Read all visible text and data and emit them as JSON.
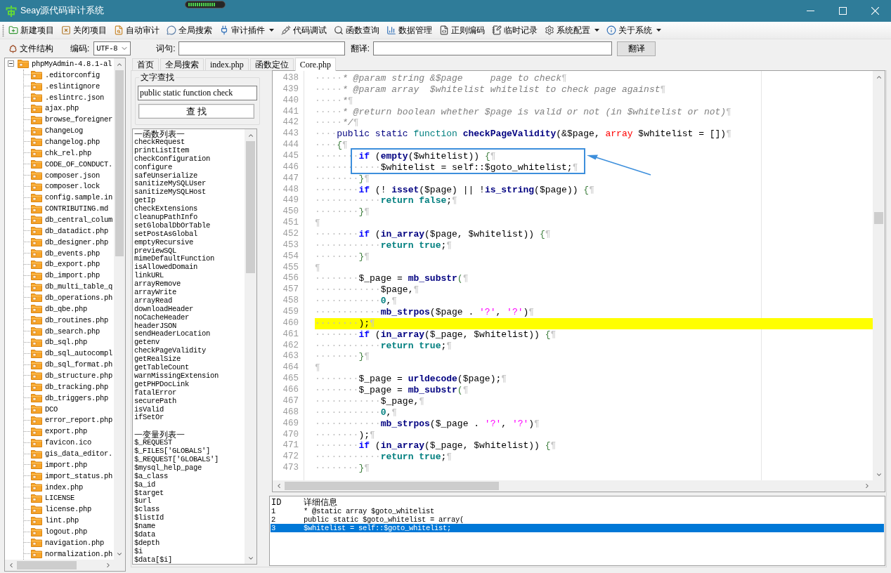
{
  "window": {
    "title": "Seay源代码审计系统"
  },
  "capture_meter": {
    "level": 0.8
  },
  "toolbar": [
    {
      "label": "新建项目",
      "dropdown": false
    },
    {
      "label": "关闭项目",
      "dropdown": false
    },
    {
      "label": "自动审计",
      "dropdown": false
    },
    {
      "label": "全局搜索",
      "dropdown": false
    },
    {
      "label": "审计插件",
      "dropdown": true
    },
    {
      "label": "代码调试",
      "dropdown": false
    },
    {
      "label": "函数查询",
      "dropdown": false
    },
    {
      "label": "数据管理",
      "dropdown": false
    },
    {
      "label": "正则编码",
      "dropdown": false
    },
    {
      "label": "临时记录",
      "dropdown": false
    },
    {
      "label": "系统配置",
      "dropdown": true
    },
    {
      "label": "关于系统",
      "dropdown": true
    }
  ],
  "options_bar": {
    "structure_button": "文件结构",
    "encoding": {
      "label": "编码:",
      "value": "UTF-8"
    },
    "phrase_label": "词句:",
    "translation_label": "翻译:",
    "translate_button": "翻译"
  },
  "file_tree": {
    "label": "phpMyAdmin-4.8.1-al",
    "expanded": true,
    "children": [
      {
        "label": ".editorconfig"
      },
      {
        "label": ".eslintignore"
      },
      {
        "label": ".eslintrc.json"
      },
      {
        "label": "ajax.php"
      },
      {
        "label": "browse_foreigner"
      },
      {
        "label": "ChangeLog"
      },
      {
        "label": "changelog.php"
      },
      {
        "label": "chk_rel.php"
      },
      {
        "label": "CODE_OF_CONDUCT."
      },
      {
        "label": "composer.json"
      },
      {
        "label": "composer.lock"
      },
      {
        "label": "config.sample.in"
      },
      {
        "label": "CONTRIBUTING.md"
      },
      {
        "label": "db_central_colum"
      },
      {
        "label": "db_datadict.php"
      },
      {
        "label": "db_designer.php"
      },
      {
        "label": "db_events.php"
      },
      {
        "label": "db_export.php"
      },
      {
        "label": "db_import.php"
      },
      {
        "label": "db_multi_table_q"
      },
      {
        "label": "db_operations.ph"
      },
      {
        "label": "db_qbe.php"
      },
      {
        "label": "db_routines.php"
      },
      {
        "label": "db_search.php"
      },
      {
        "label": "db_sql.php"
      },
      {
        "label": "db_sql_autocompl"
      },
      {
        "label": "db_sql_format.ph"
      },
      {
        "label": "db_structure.php"
      },
      {
        "label": "db_tracking.php"
      },
      {
        "label": "db_triggers.php"
      },
      {
        "label": "DCO"
      },
      {
        "label": "error_report.php"
      },
      {
        "label": "export.php"
      },
      {
        "label": "favicon.ico"
      },
      {
        "label": "gis_data_editor."
      },
      {
        "label": "import.php"
      },
      {
        "label": "import_status.ph"
      },
      {
        "label": "index.php"
      },
      {
        "label": "LICENSE"
      },
      {
        "label": "license.php"
      },
      {
        "label": "lint.php"
      },
      {
        "label": "logout.php"
      },
      {
        "label": "navigation.php"
      },
      {
        "label": "normalization.ph"
      }
    ]
  },
  "tabs": [
    {
      "label": "首页",
      "selected": false
    },
    {
      "label": "全局搜索",
      "selected": false
    },
    {
      "label": "index.php",
      "selected": false
    },
    {
      "label": "函数定位",
      "selected": false
    },
    {
      "label": "Core.php",
      "selected": true
    }
  ],
  "text_search": {
    "title": "文字查找",
    "query": "public static function check",
    "button": "查 找"
  },
  "symbol_list": [
    {
      "heading": "一函数列表一",
      "items": [
        "checkRequest",
        "printListItem",
        "checkConfiguration",
        "configure",
        "safeUnserialize",
        "sanitizeMySQLUser",
        "sanitizeMySQLHost",
        "getIp",
        "checkExtensions",
        "cleanupPathInfo",
        "setGlobalDbOrTable",
        "setPostAsGlobal",
        "emptyRecursive",
        "previewSQL",
        "mimeDefaultFunction",
        "isAllowedDomain",
        "linkURL",
        "arrayRemove",
        "arrayWrite",
        "arrayRead",
        "downloadHeader",
        "noCacheHeader",
        "headerJSON",
        "sendHeaderLocation",
        "getenv",
        "checkPageValidity",
        "getRealSize",
        "getTableCount",
        "warnMissingExtension",
        "getPHPDocLink",
        "fatalError",
        "securePath",
        "isValid",
        "ifSetOr"
      ]
    },
    {
      "heading": "一变量列表一",
      "items": [
        "$_REQUEST",
        "$_FILES['GLOBALS']",
        "$_REQUEST['GLOBALS']",
        "$mysql_help_page",
        "$a_class",
        "$a_id",
        "$target",
        "$url",
        "$class",
        "$listId",
        "$name",
        "$data",
        "$depth",
        "$i",
        "$data[$i]"
      ]
    }
  ],
  "editor": {
    "lines": [
      {
        "number": "438",
        "indent": "·····",
        "tokens": [
          {
            "kind": "comment",
            "text": "* @param string &$page     page to check"
          }
        ],
        "eol": "¶",
        "current": false
      },
      {
        "number": "439",
        "indent": "·····",
        "tokens": [
          {
            "kind": "comment",
            "text": "* @param array  $whitelist whitelist to check page against"
          }
        ],
        "eol": "¶",
        "current": false
      },
      {
        "number": "440",
        "indent": "·····",
        "tokens": [
          {
            "kind": "comment",
            "text": "*"
          }
        ],
        "eol": "¶",
        "current": false
      },
      {
        "number": "441",
        "indent": "·····",
        "tokens": [
          {
            "kind": "comment",
            "text": "* @return boolean whether $page is valid or not (in $whitelist or not)"
          }
        ],
        "eol": "¶",
        "current": false
      },
      {
        "number": "442",
        "indent": "·····",
        "tokens": [
          {
            "kind": "comment",
            "text": "*/"
          }
        ],
        "eol": "¶",
        "current": false
      },
      {
        "number": "443",
        "indent": "····",
        "tokens": [
          {
            "kind": "modifier",
            "text": "public"
          },
          {
            "kind": "modifier",
            "text": " static"
          },
          {
            "kind": "declare",
            "text": " function"
          },
          {
            "kind": "call",
            "text": " checkPageValidity"
          },
          {
            "kind": "plain",
            "text": "(&$page, "
          },
          {
            "kind": "type",
            "text": "array"
          },
          {
            "kind": "plain",
            "text": " $whitelist = [])"
          }
        ],
        "eol": "¶",
        "current": false
      },
      {
        "number": "444",
        "indent": "····",
        "tokens": [
          {
            "kind": "brace",
            "text": "{"
          }
        ],
        "eol": "¶",
        "current": false
      },
      {
        "number": "445",
        "indent": "········",
        "tokens": [
          {
            "kind": "keyword",
            "text": "if"
          },
          {
            "kind": "plain",
            "text": " ("
          },
          {
            "kind": "call",
            "text": "empty"
          },
          {
            "kind": "plain",
            "text": "($whitelist)) "
          },
          {
            "kind": "brace",
            "text": "{"
          }
        ],
        "eol": "¶",
        "current": false
      },
      {
        "number": "446",
        "indent": "············",
        "tokens": [
          {
            "kind": "plain",
            "text": "$whitelist = self::$goto_whitelist;"
          }
        ],
        "eol": "¶",
        "current": false
      },
      {
        "number": "447",
        "indent": "········",
        "tokens": [
          {
            "kind": "brace",
            "text": "}"
          }
        ],
        "eol": "¶",
        "current": false
      },
      {
        "number": "448",
        "indent": "········",
        "tokens": [
          {
            "kind": "keyword",
            "text": "if"
          },
          {
            "kind": "plain",
            "text": " (! "
          },
          {
            "kind": "call",
            "text": "isset"
          },
          {
            "kind": "plain",
            "text": "($page) || !"
          },
          {
            "kind": "call",
            "text": "is_string"
          },
          {
            "kind": "plain",
            "text": "($page)) "
          },
          {
            "kind": "brace",
            "text": "{"
          }
        ],
        "eol": "¶",
        "current": false
      },
      {
        "number": "449",
        "indent": "············",
        "tokens": [
          {
            "kind": "literal",
            "text": "return false"
          },
          {
            "kind": "plain",
            "text": ";"
          }
        ],
        "eol": "¶",
        "current": false
      },
      {
        "number": "450",
        "indent": "········",
        "tokens": [
          {
            "kind": "brace",
            "text": "}"
          }
        ],
        "eol": "¶",
        "current": false
      },
      {
        "number": "451",
        "eol": "¶",
        "current": false
      },
      {
        "number": "452",
        "indent": "········",
        "tokens": [
          {
            "kind": "keyword",
            "text": "if"
          },
          {
            "kind": "plain",
            "text": " ("
          },
          {
            "kind": "call",
            "text": "in_array"
          },
          {
            "kind": "plain",
            "text": "($page, $whitelist)) "
          },
          {
            "kind": "brace",
            "text": "{"
          }
        ],
        "eol": "¶",
        "current": false
      },
      {
        "number": "453",
        "indent": "············",
        "tokens": [
          {
            "kind": "literal",
            "text": "return true"
          },
          {
            "kind": "plain",
            "text": ";"
          }
        ],
        "eol": "¶",
        "current": false
      },
      {
        "number": "454",
        "indent": "········",
        "tokens": [
          {
            "kind": "brace",
            "text": "}"
          }
        ],
        "eol": "¶",
        "current": false
      },
      {
        "number": "455",
        "eol": "¶",
        "current": false
      },
      {
        "number": "456",
        "indent": "········",
        "tokens": [
          {
            "kind": "plain",
            "text": "$_page = "
          },
          {
            "kind": "call",
            "text": "mb_substr"
          },
          {
            "kind": "brace",
            "text": "("
          }
        ],
        "eol": "¶",
        "current": false
      },
      {
        "number": "457",
        "indent": "············",
        "tokens": [
          {
            "kind": "plain",
            "text": "$page,"
          }
        ],
        "eol": "¶",
        "current": false
      },
      {
        "number": "458",
        "indent": "············",
        "tokens": [
          {
            "kind": "literal",
            "text": "0"
          },
          {
            "kind": "plain",
            "text": ","
          }
        ],
        "eol": "¶",
        "current": false
      },
      {
        "number": "459",
        "indent": "············",
        "tokens": [
          {
            "kind": "call",
            "text": "mb_strpos"
          },
          {
            "kind": "plain",
            "text": "($page . "
          },
          {
            "kind": "string",
            "text": "'?'"
          },
          {
            "kind": "plain",
            "text": ", "
          },
          {
            "kind": "string",
            "text": "'?'"
          },
          {
            "kind": "plain",
            "text": ")"
          }
        ],
        "eol": "¶",
        "current": false
      },
      {
        "number": "460",
        "indent": "········",
        "tokens": [
          {
            "kind": "plain",
            "text": ");"
          }
        ],
        "eol": "¶",
        "current": true
      },
      {
        "number": "461",
        "indent": "········",
        "tokens": [
          {
            "kind": "keyword",
            "text": "if"
          },
          {
            "kind": "plain",
            "text": " ("
          },
          {
            "kind": "call",
            "text": "in_array"
          },
          {
            "kind": "plain",
            "text": "($_page, $whitelist)) "
          },
          {
            "kind": "brace",
            "text": "{"
          }
        ],
        "eol": "¶",
        "current": false
      },
      {
        "number": "462",
        "indent": "············",
        "tokens": [
          {
            "kind": "literal",
            "text": "return true"
          },
          {
            "kind": "plain",
            "text": ";"
          }
        ],
        "eol": "¶",
        "current": false
      },
      {
        "number": "463",
        "indent": "········",
        "tokens": [
          {
            "kind": "brace",
            "text": "}"
          }
        ],
        "eol": "¶",
        "current": false
      },
      {
        "number": "464",
        "eol": "¶",
        "current": false
      },
      {
        "number": "465",
        "indent": "········",
        "tokens": [
          {
            "kind": "plain",
            "text": "$_page = "
          },
          {
            "kind": "call",
            "text": "urldecode"
          },
          {
            "kind": "plain",
            "text": "($page);"
          }
        ],
        "eol": "¶",
        "current": false
      },
      {
        "number": "466",
        "indent": "········",
        "tokens": [
          {
            "kind": "plain",
            "text": "$_page = "
          },
          {
            "kind": "call",
            "text": "mb_substr"
          },
          {
            "kind": "brace",
            "text": "("
          }
        ],
        "eol": "¶",
        "current": false
      },
      {
        "number": "467",
        "indent": "············",
        "tokens": [
          {
            "kind": "plain",
            "text": "$_page,"
          }
        ],
        "eol": "¶",
        "current": false
      },
      {
        "number": "468",
        "indent": "············",
        "tokens": [
          {
            "kind": "literal",
            "text": "0"
          },
          {
            "kind": "plain",
            "text": ","
          }
        ],
        "eol": "¶",
        "current": false
      },
      {
        "number": "469",
        "indent": "············",
        "tokens": [
          {
            "kind": "call",
            "text": "mb_strpos"
          },
          {
            "kind": "plain",
            "text": "($_page . "
          },
          {
            "kind": "string",
            "text": "'?'"
          },
          {
            "kind": "plain",
            "text": ", "
          },
          {
            "kind": "string",
            "text": "'?'"
          },
          {
            "kind": "plain",
            "text": ")"
          }
        ],
        "eol": "¶",
        "current": false
      },
      {
        "number": "470",
        "indent": "········",
        "tokens": [
          {
            "kind": "plain",
            "text": ");"
          }
        ],
        "eol": "¶",
        "current": false
      },
      {
        "number": "471",
        "indent": "········",
        "tokens": [
          {
            "kind": "keyword",
            "text": "if"
          },
          {
            "kind": "plain",
            "text": " ("
          },
          {
            "kind": "call",
            "text": "in_array"
          },
          {
            "kind": "plain",
            "text": "($_page, $whitelist)) "
          },
          {
            "kind": "brace",
            "text": "{"
          }
        ],
        "eol": "¶",
        "current": false
      },
      {
        "number": "472",
        "indent": "············",
        "tokens": [
          {
            "kind": "literal",
            "text": "return true"
          },
          {
            "kind": "plain",
            "text": ";"
          }
        ],
        "eol": "¶",
        "current": false
      },
      {
        "number": "473",
        "indent": "········",
        "tokens": [
          {
            "kind": "brace",
            "text": "}"
          }
        ],
        "eol": "¶",
        "current": false
      }
    ]
  },
  "details": {
    "columns": [
      "ID",
      "详细信息"
    ],
    "rows": [
      {
        "id": "1",
        "text": "* @static array $goto_whitelist",
        "selected": false
      },
      {
        "id": "2",
        "text": "public static $goto_whitelist = array(",
        "selected": false
      },
      {
        "id": "3",
        "text": "$whitelist = self::$goto_whitelist;",
        "selected": true
      }
    ]
  }
}
